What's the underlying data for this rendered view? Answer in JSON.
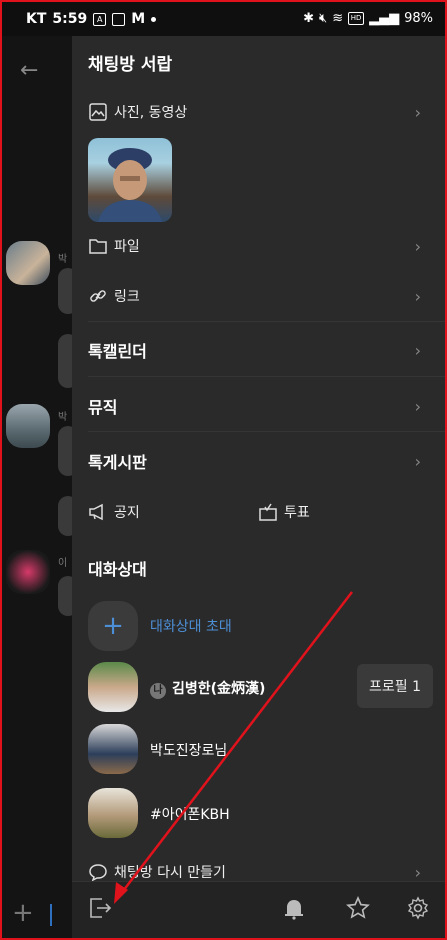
{
  "status": {
    "carrier": "KT",
    "time": "5:59",
    "battery": "98%",
    "icons": [
      "app-a-icon",
      "notification-icon",
      "gmail-icon",
      "bluetooth-icon",
      "mute-icon",
      "wifi-icon",
      "hd-icon",
      "signal-icon"
    ]
  },
  "drawer": {
    "title": "채팅방 서랍",
    "photos_label": "사진, 동영상",
    "files_label": "파일",
    "links_label": "링크",
    "calendar_label": "톡캘린더",
    "music_label": "뮤직",
    "board_label": "톡게시판",
    "notice_label": "공지",
    "vote_label": "투표",
    "members_title": "대화상대",
    "invite_label": "대화상대 초대",
    "members": [
      {
        "badge": "나",
        "name": "김병한(金炳漢)"
      },
      {
        "name": "박도진장로님"
      },
      {
        "name": "#아이폰KBH"
      }
    ],
    "profile_button": "프로필 1",
    "recreate_label": "채팅방 다시 만들기"
  },
  "colors": {
    "accent": "#4d8fd6",
    "annotation": "#e0121b"
  }
}
